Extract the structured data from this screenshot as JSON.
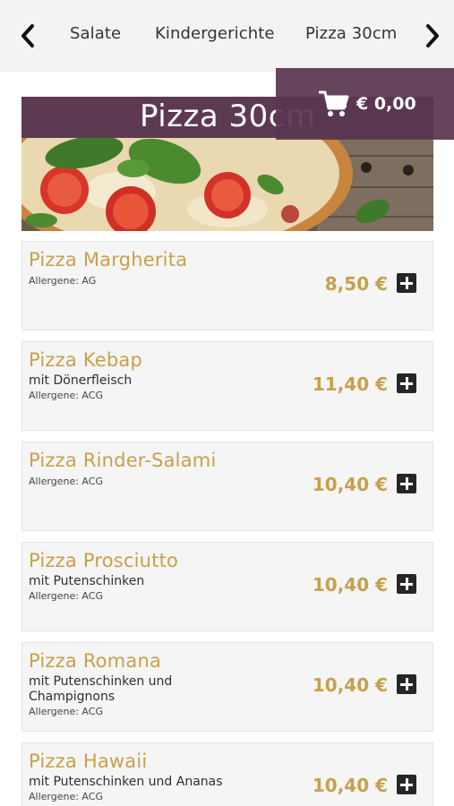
{
  "nav": {
    "items": [
      "Salate",
      "Kindergerichte",
      "Pizza 30cm"
    ]
  },
  "category": {
    "title": "Pizza 30cm"
  },
  "cart": {
    "total": "€ 0,00"
  },
  "products": [
    {
      "name": "Pizza Margherita",
      "description": "",
      "allergens": "Allergene: AG",
      "price": "8,50 €"
    },
    {
      "name": "Pizza Kebap",
      "description": "mit Dönerfleisch",
      "allergens": "Allergene: ACG",
      "price": "11,40 €"
    },
    {
      "name": "Pizza Rinder-Salami",
      "description": "",
      "allergens": "Allergene: ACG",
      "price": "10,40 €"
    },
    {
      "name": "Pizza Prosciutto",
      "description": "mit Putenschinken",
      "allergens": "Allergene: ACG",
      "price": "10,40 €"
    },
    {
      "name": "Pizza Romana",
      "description": "mit Putenschinken und Champignons",
      "allergens": "Allergene: ACG",
      "price": "10,40 €"
    },
    {
      "name": "Pizza Hawaii",
      "description": "mit Putenschinken und Ananas",
      "allergens": "Allergene: ACG",
      "price": "10,40 €"
    }
  ],
  "colors": {
    "accent": "#c7a04b",
    "brand": "#5d3a52"
  }
}
